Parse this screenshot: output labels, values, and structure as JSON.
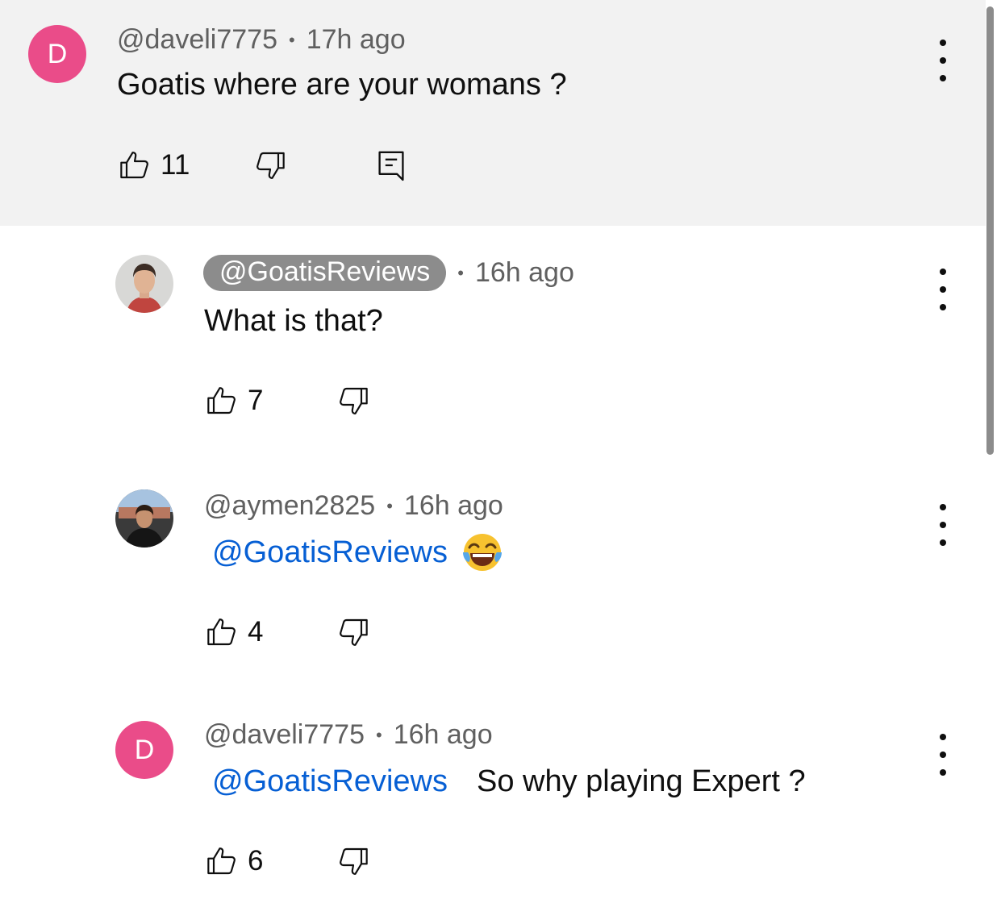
{
  "colors": {
    "top_comment_bg": "#f2f2f2",
    "avatar_letter_bg": "#ea4c89",
    "mention_link": "#065fd4",
    "owner_chip_bg": "#8c8c8c",
    "meta_text": "#606060"
  },
  "icons": {
    "like": "thumb-up-outline",
    "dislike": "thumb-down-outline",
    "reply": "comment-outline",
    "more": "three-vertical-dots"
  },
  "comments": [
    {
      "avatar_letter": "D",
      "author": "@daveli7775",
      "time": "17h ago",
      "text": "Goatis where are your womans ?",
      "likes": "11",
      "has_reply_button": true
    },
    {
      "avatar_type": "photo",
      "author": "@GoatisReviews",
      "author_is_owner": true,
      "time": "16h ago",
      "text": "What is that?",
      "likes": "7"
    },
    {
      "avatar_type": "photo",
      "author": "@aymen2825",
      "time": "16h ago",
      "mention": "@GoatisReviews",
      "emoji": "face-with-tears-of-joy",
      "likes": "4"
    },
    {
      "avatar_letter": "D",
      "author": "@daveli7775",
      "time": "16h ago",
      "mention": "@GoatisReviews",
      "text": "So why playing Expert ?",
      "likes": "6"
    }
  ]
}
